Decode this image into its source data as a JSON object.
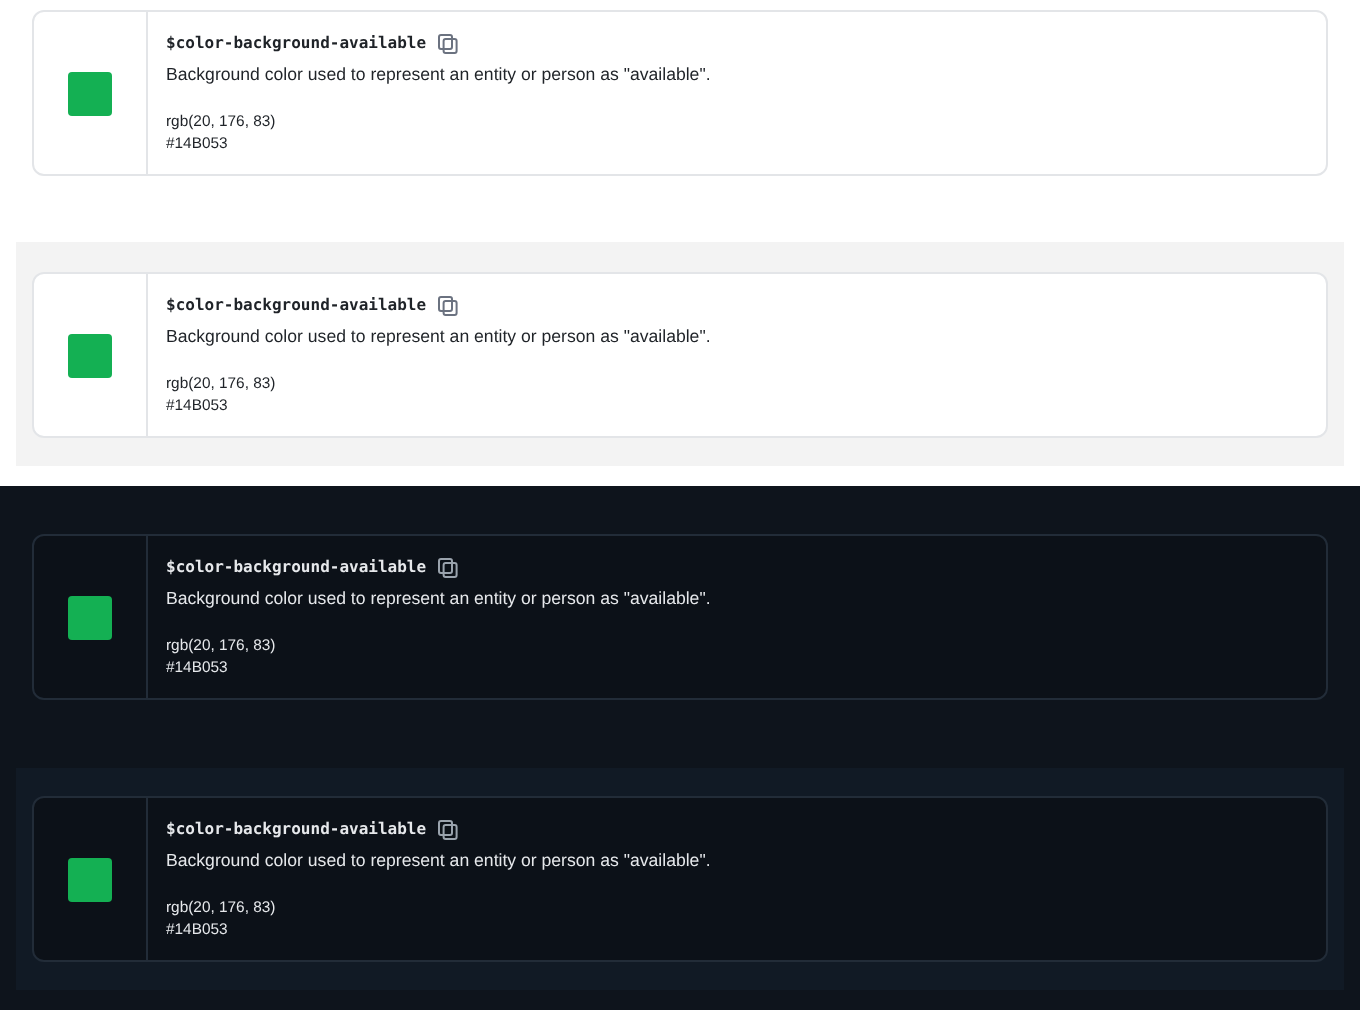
{
  "panels": [
    {
      "dark": false,
      "shaded": false,
      "card": {
        "token": "$color-background-available",
        "color": "#14b053",
        "description": "Background color used to represent an entity or person as \"available\".",
        "rgb": "rgb(20, 176, 83)",
        "hex": "#14B053"
      }
    },
    {
      "dark": false,
      "shaded": true,
      "card": {
        "token": "$color-background-available",
        "color": "#14b053",
        "description": "Background color used to represent an entity or person as \"available\".",
        "rgb": "rgb(20, 176, 83)",
        "hex": "#14B053"
      }
    },
    {
      "dark": true,
      "shaded": false,
      "card": {
        "token": "$color-background-available",
        "color": "#14b053",
        "description": "Background color used to represent an entity or person as \"available\".",
        "rgb": "rgb(20, 176, 83)",
        "hex": "#14B053"
      }
    },
    {
      "dark": true,
      "shaded": true,
      "card": {
        "token": "$color-background-available",
        "color": "#14b053",
        "description": "Background color used to represent an entity or person as \"available\".",
        "rgb": "rgb(20, 176, 83)",
        "hex": "#14B053"
      }
    }
  ]
}
